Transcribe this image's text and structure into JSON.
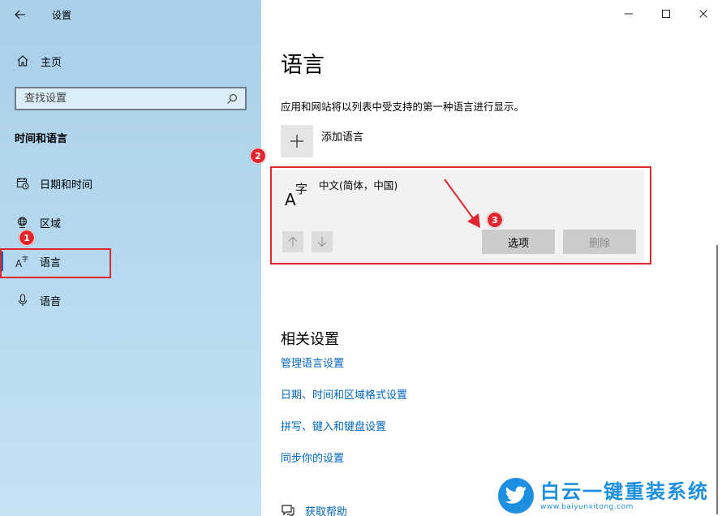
{
  "window": {
    "title": "设置"
  },
  "sidebar": {
    "home_label": "主页",
    "search_placeholder": "查找设置",
    "section_title": "时间和语言",
    "items": [
      {
        "label": "日期和时间",
        "icon": "calendar-clock-icon"
      },
      {
        "label": "区域",
        "icon": "globe-icon"
      },
      {
        "label": "语言",
        "icon": "language-icon",
        "active": true
      },
      {
        "label": "语音",
        "icon": "microphone-icon"
      }
    ]
  },
  "main": {
    "title": "语言",
    "description": "应用和网站将以列表中受支持的第一种语言进行显示。",
    "add_language_label": "添加语言",
    "language_card": {
      "name": "中文(简体，中国)",
      "options_label": "选项",
      "remove_label": "删除"
    },
    "related": {
      "title": "相关设置",
      "links": [
        "管理语言设置",
        "日期、时间和区域格式设置",
        "拼写、键入和键盘设置",
        "同步你的设置"
      ]
    },
    "help_label": "获取帮助"
  },
  "annotations": {
    "badge_1": "1",
    "badge_2": "2",
    "badge_3": "3"
  },
  "watermark": {
    "brand": "白云一键重装系统",
    "url": "www.baiyunxitong.com"
  },
  "colors": {
    "accent": "#0067c0",
    "annotation": "#e2262f",
    "sidebar_bg": "#b6daef"
  }
}
